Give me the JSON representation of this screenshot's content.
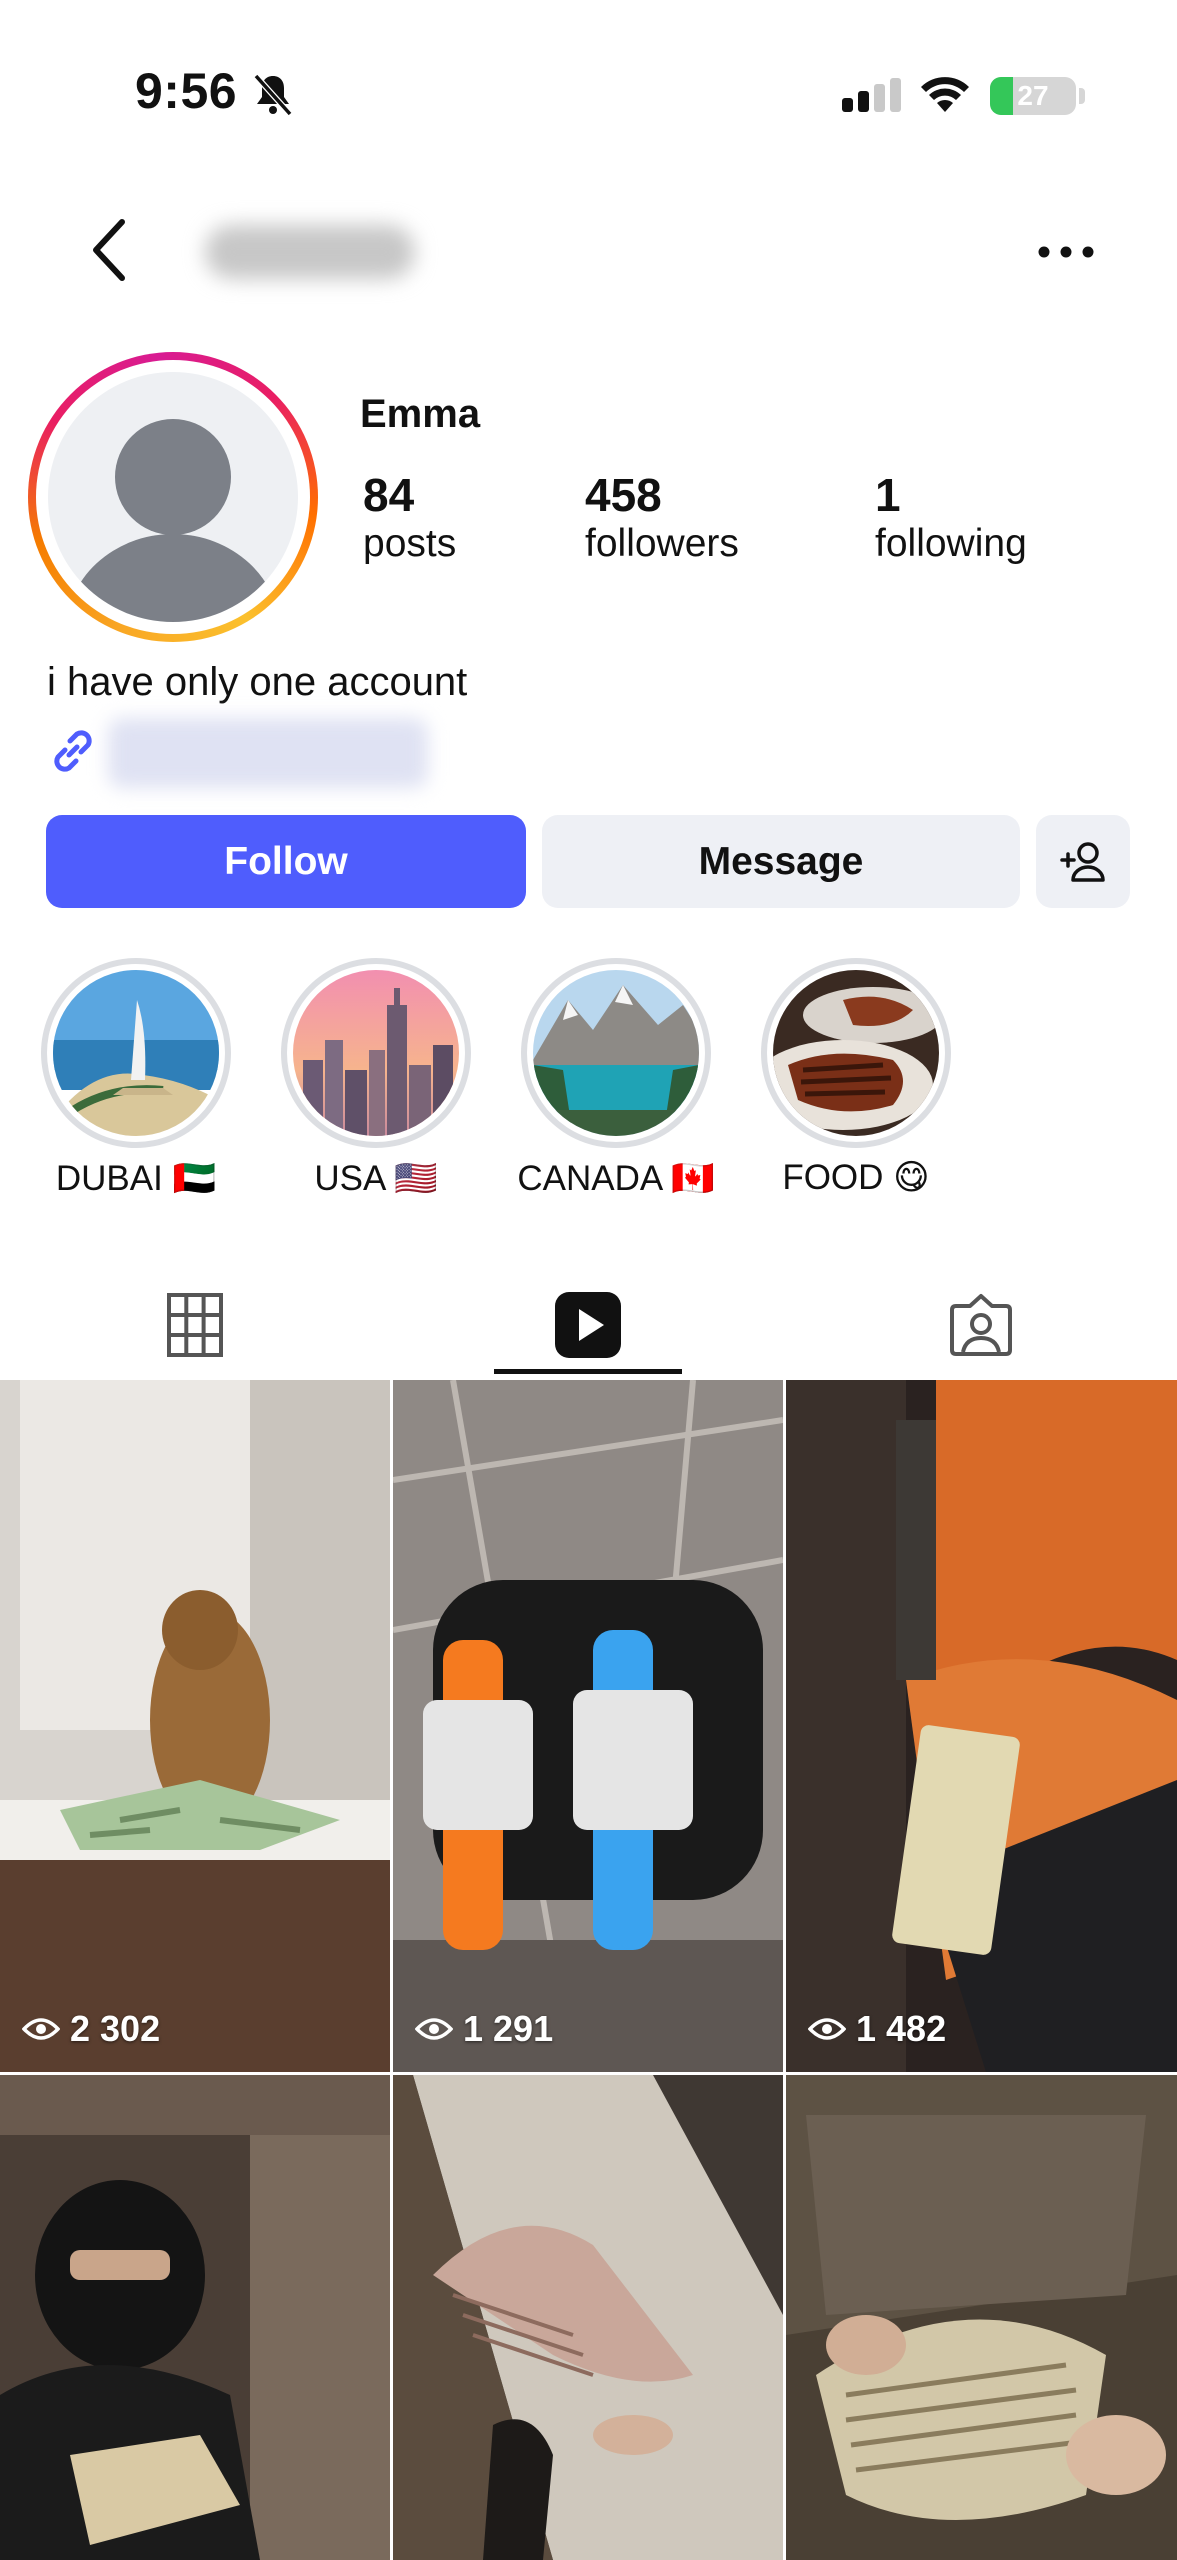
{
  "status_bar": {
    "time": "9:56",
    "battery": "27",
    "battery_level": 0.27
  },
  "profile": {
    "name": "Emma",
    "stats": [
      {
        "value": "84",
        "label": "posts"
      },
      {
        "value": "458",
        "label": "followers"
      },
      {
        "value": "1",
        "label": "following"
      }
    ],
    "bio": "i have only one account"
  },
  "actions": {
    "follow_label": "Follow",
    "message_label": "Message"
  },
  "highlights": [
    {
      "label": "DUBAI 🇦🇪"
    },
    {
      "label": "USA 🇺🇸"
    },
    {
      "label": "CANADA 🇨🇦"
    },
    {
      "label": "FOOD 😋"
    }
  ],
  "tabs": [
    {
      "icon": "grid-icon"
    },
    {
      "icon": "reels-icon",
      "selected": true
    },
    {
      "icon": "tagged-icon"
    }
  ],
  "reels": [
    {
      "views": "2 302"
    },
    {
      "views": "1 291"
    },
    {
      "views": "1 482"
    },
    {
      "views": ""
    },
    {
      "views": ""
    },
    {
      "views": ""
    }
  ],
  "colors": {
    "follow_button": "#4f5dfd",
    "secondary_button": "#eef0f5",
    "battery": "#34c759"
  }
}
